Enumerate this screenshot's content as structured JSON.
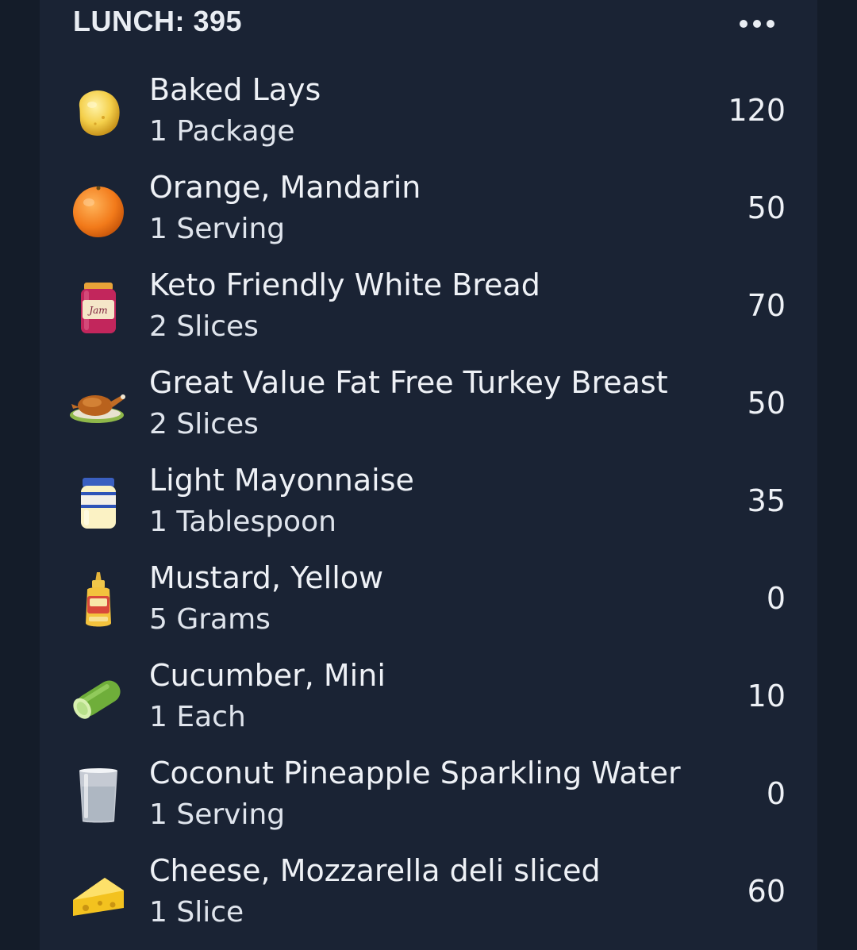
{
  "meal": {
    "title": "LUNCH: 395",
    "more_icon": "more-horizontal-icon"
  },
  "items": [
    {
      "name": "Baked Lays",
      "serving": "1 Package",
      "calories": "120",
      "icon": "chip-icon"
    },
    {
      "name": "Orange, Mandarin",
      "serving": "1 Serving",
      "calories": "50",
      "icon": "orange-icon"
    },
    {
      "name": "Keto Friendly White Bread",
      "serving": "2 Slices",
      "calories": "70",
      "icon": "jam-jar-icon",
      "icon_text": "Jam"
    },
    {
      "name": "Great Value Fat Free Turkey Breast",
      "serving": "2 Slices",
      "calories": "50",
      "icon": "roast-turkey-icon"
    },
    {
      "name": "Light Mayonnaise",
      "serving": "1 Tablespoon",
      "calories": "35",
      "icon": "mayonnaise-jar-icon"
    },
    {
      "name": "Mustard, Yellow",
      "serving": "5 Grams",
      "calories": "0",
      "icon": "mustard-bottle-icon"
    },
    {
      "name": "Cucumber, Mini",
      "serving": "1 Each",
      "calories": "10",
      "icon": "cucumber-icon"
    },
    {
      "name": "Coconut Pineapple Sparkling Water",
      "serving": "1 Serving",
      "calories": "0",
      "icon": "water-glass-icon"
    },
    {
      "name": "Cheese, Mozzarella deli sliced",
      "serving": "1 Slice",
      "calories": "60",
      "icon": "cheese-wedge-icon"
    }
  ],
  "colors": {
    "page_background": "#141c29",
    "card_background": "#1a2334",
    "text_primary": "#eef1f6"
  }
}
